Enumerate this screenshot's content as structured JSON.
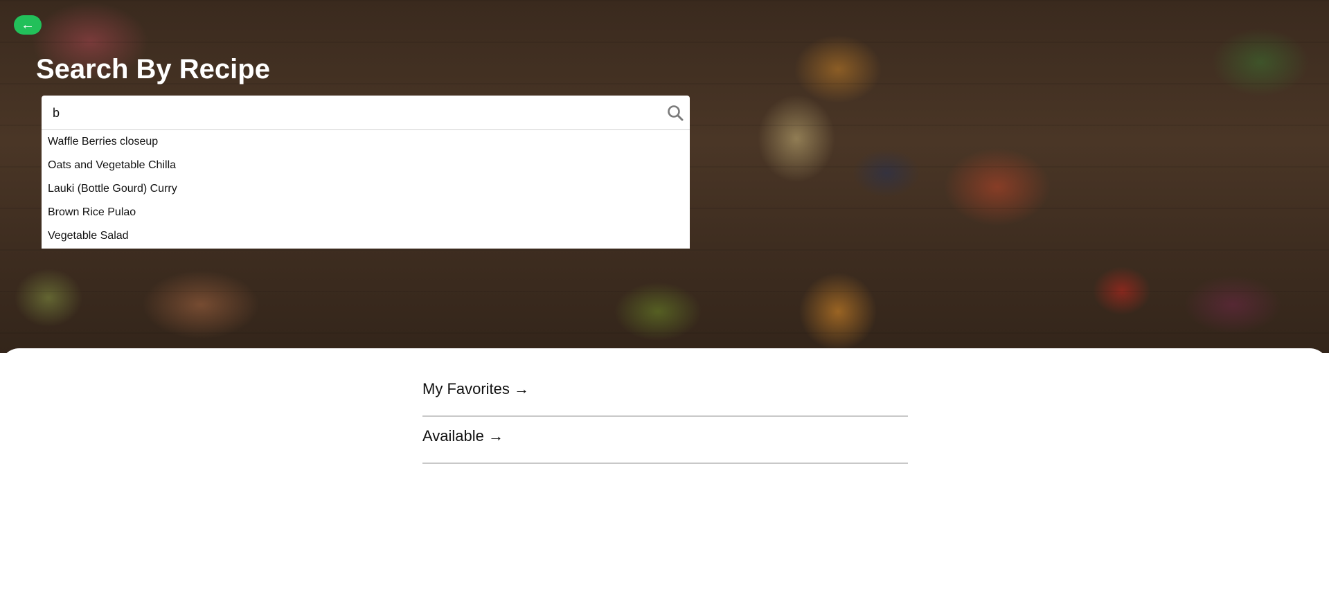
{
  "header": {
    "back_label": "←",
    "title": "Search By Recipe"
  },
  "search": {
    "value": "b",
    "placeholder": "",
    "icon": "search-icon"
  },
  "suggestions": [
    "Waffle Berries closeup",
    "Oats and Vegetable Chilla",
    "Lauki (Bottle Gourd) Curry",
    "Brown Rice Pulao",
    "Vegetable Salad"
  ],
  "links": {
    "favorites": "My Favorites →",
    "available": "Available →"
  },
  "colors": {
    "accent": "#22c05a",
    "divider": "#c8c8c8"
  }
}
